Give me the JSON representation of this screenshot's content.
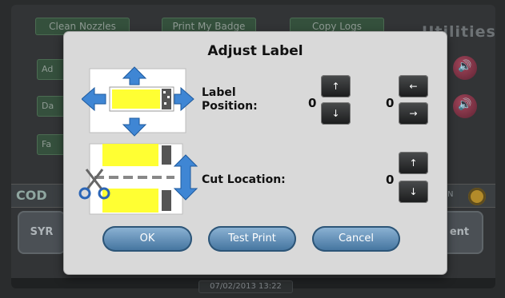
{
  "background": {
    "title": "Utilities",
    "buttons": [
      "Clean Nozzles",
      "Print My Badge",
      "Copy Logs"
    ],
    "side_buttons": [
      "Ad",
      "Da",
      "Fa"
    ],
    "brand": "COD",
    "brand_status": "N",
    "bottom_left": "SYR",
    "bottom_right": "ent",
    "timestamp": "07/02/2013 13:22"
  },
  "dialog": {
    "title": "Adjust Label",
    "label_position": {
      "label": "Label Position:",
      "vertical_value": "0",
      "horizontal_value": "0",
      "up_glyph": "↑",
      "down_glyph": "↓",
      "left_glyph": "←",
      "right_glyph": "→"
    },
    "cut_location": {
      "label": "Cut Location:",
      "value": "0",
      "up_glyph": "↑",
      "down_glyph": "↓"
    },
    "buttons": {
      "ok": "OK",
      "test_print": "Test Print",
      "cancel": "Cancel"
    }
  },
  "colors": {
    "label_yellow": "#ffff33",
    "arrow_blue": "#3f86d4",
    "button_blue": "#5f8fb8",
    "dialog_bg": "#d9d9d9"
  }
}
